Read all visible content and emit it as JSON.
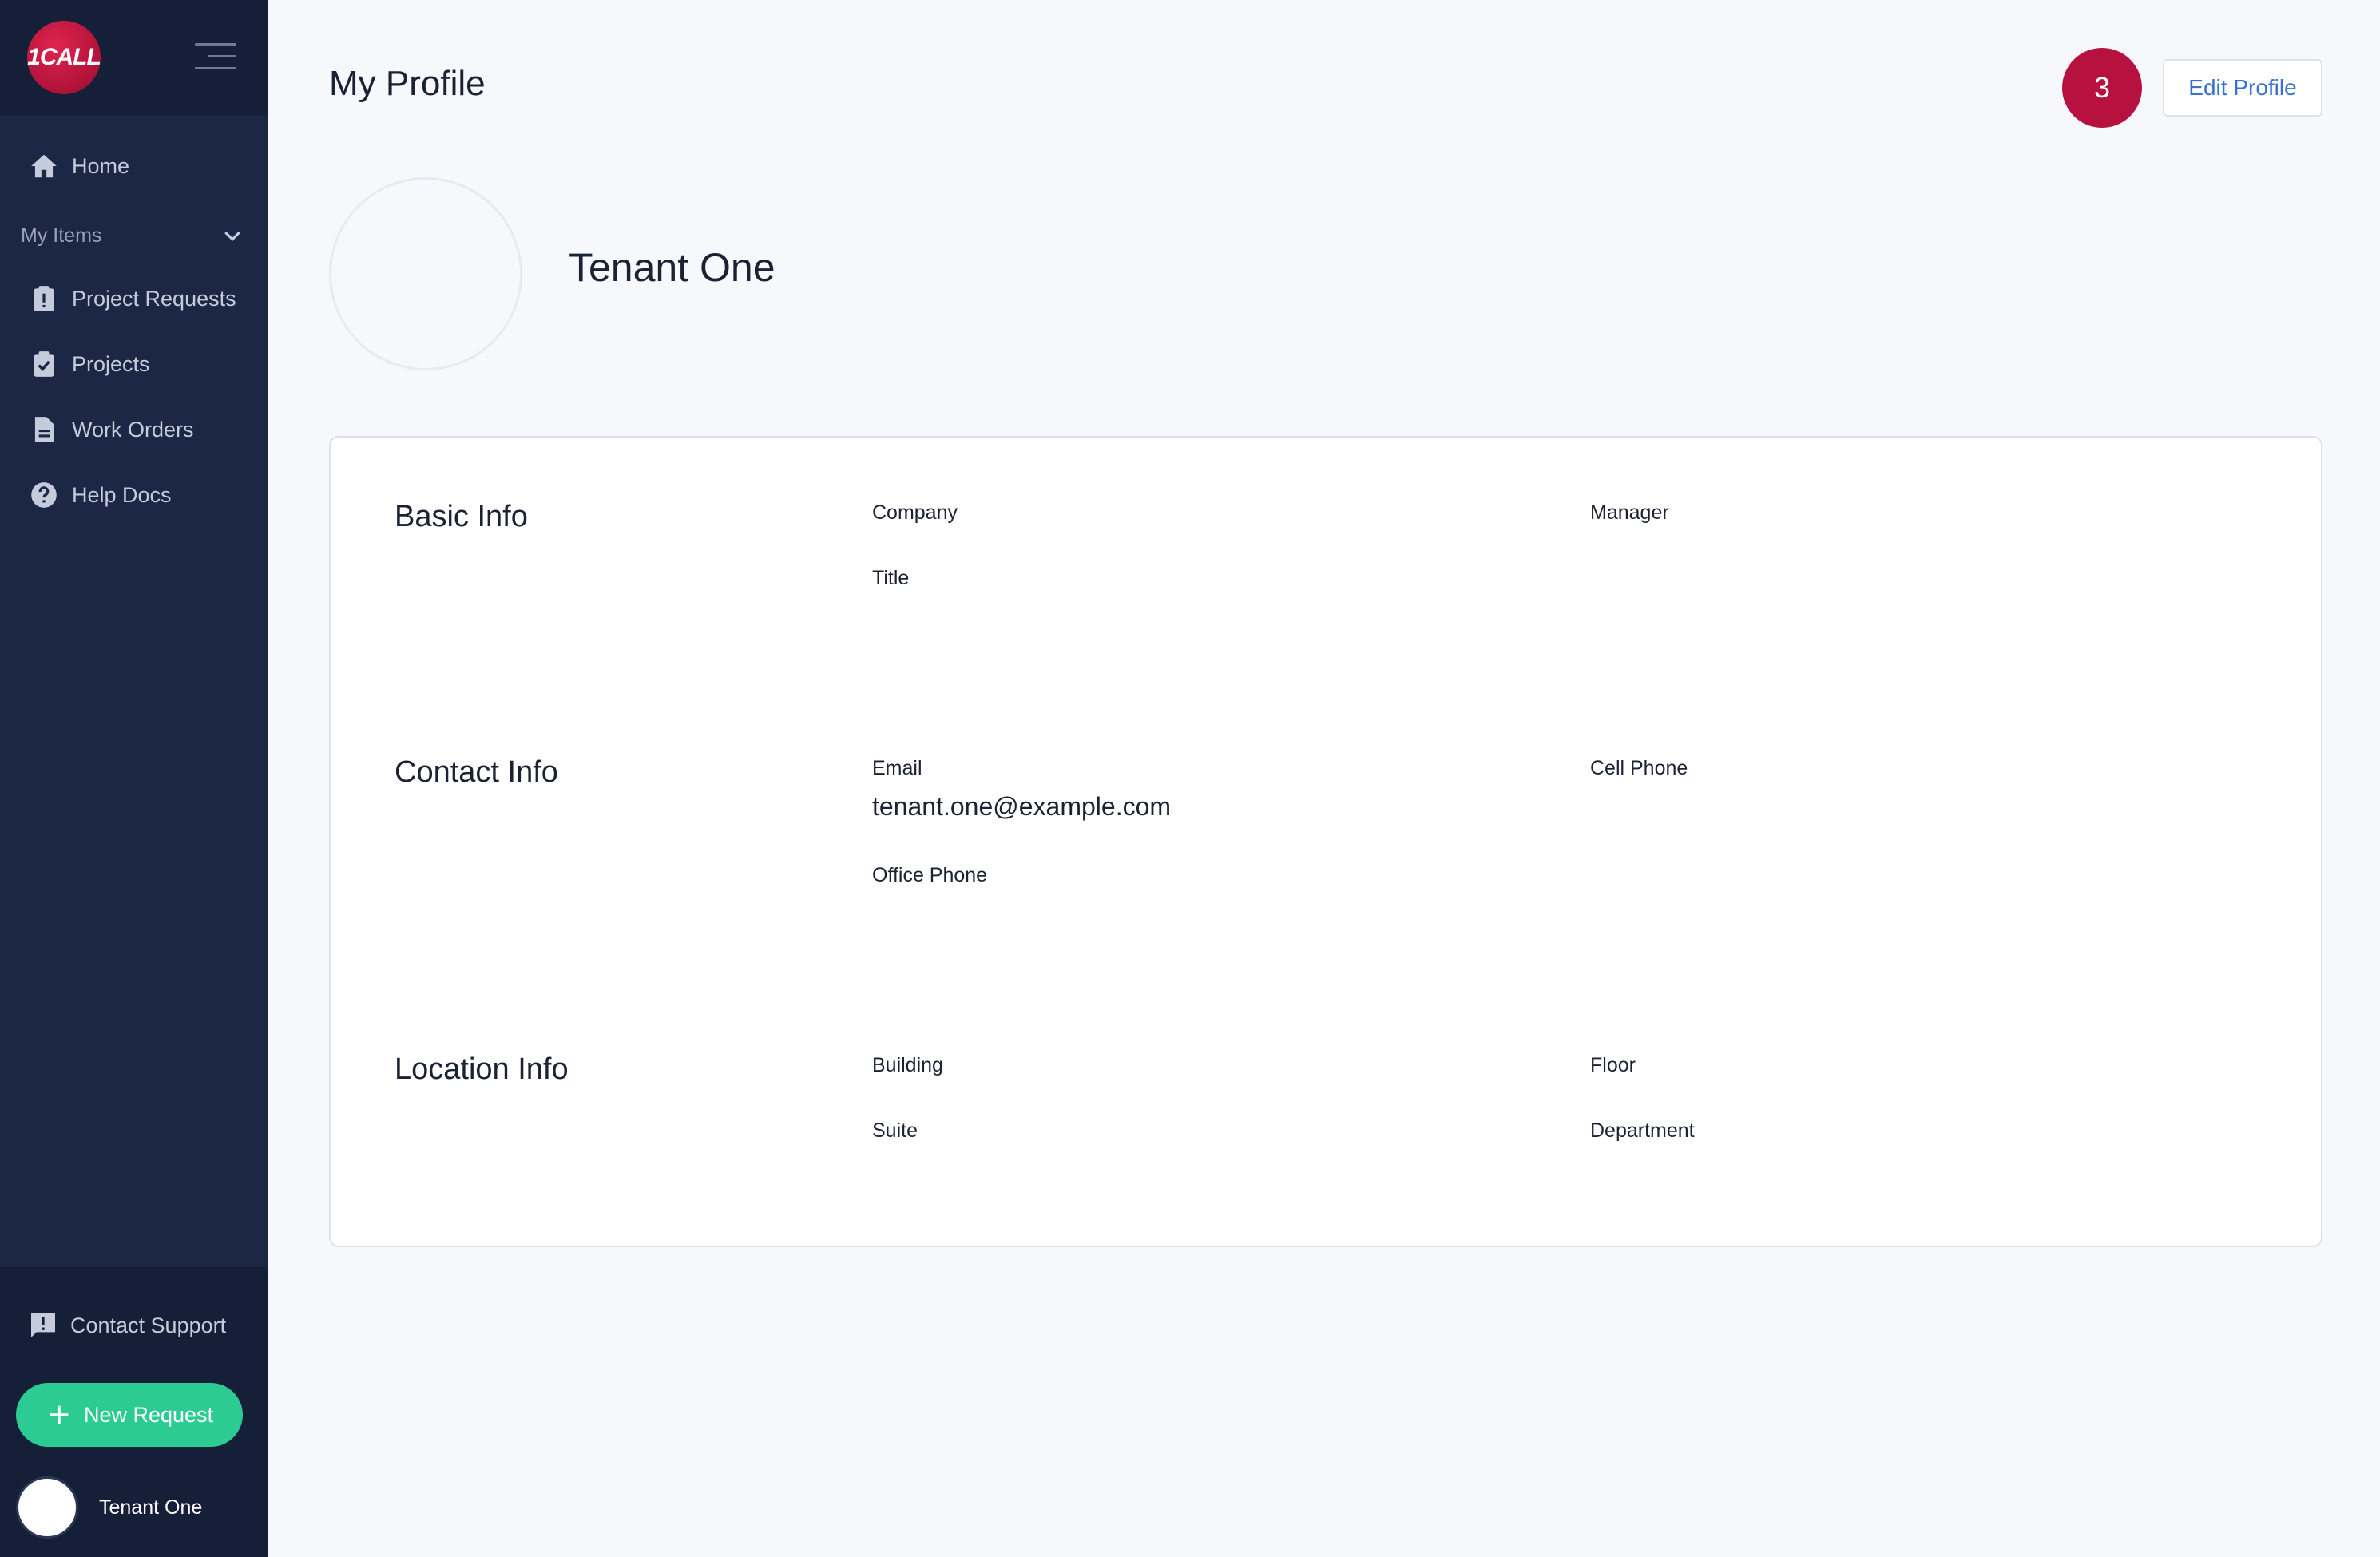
{
  "app": {
    "logo_text": "1CALL"
  },
  "sidebar": {
    "home_label": "Home",
    "section_label": "My Items",
    "items": [
      {
        "label": "Project Requests"
      },
      {
        "label": "Projects"
      },
      {
        "label": "Work Orders"
      },
      {
        "label": "Help Docs"
      }
    ],
    "support_label": "Contact Support",
    "new_request_label": "New Request",
    "user_name": "Tenant One"
  },
  "header": {
    "title": "My Profile",
    "notification_count": "3",
    "edit_label": "Edit Profile"
  },
  "profile": {
    "name": "Tenant One",
    "sections": {
      "basic": {
        "title": "Basic Info",
        "company_label": "Company",
        "manager_label": "Manager",
        "title_label": "Title"
      },
      "contact": {
        "title": "Contact Info",
        "email_label": "Email",
        "email_value": "tenant.one@example.com",
        "cell_label": "Cell Phone",
        "office_label": "Office Phone"
      },
      "location": {
        "title": "Location Info",
        "building_label": "Building",
        "floor_label": "Floor",
        "suite_label": "Suite",
        "department_label": "Department"
      }
    }
  },
  "colors": {
    "sidebar_bg": "#1b2744",
    "accent_green": "#2dcb94",
    "badge_red": "#b7123f",
    "link_blue": "#3b6fd0"
  }
}
